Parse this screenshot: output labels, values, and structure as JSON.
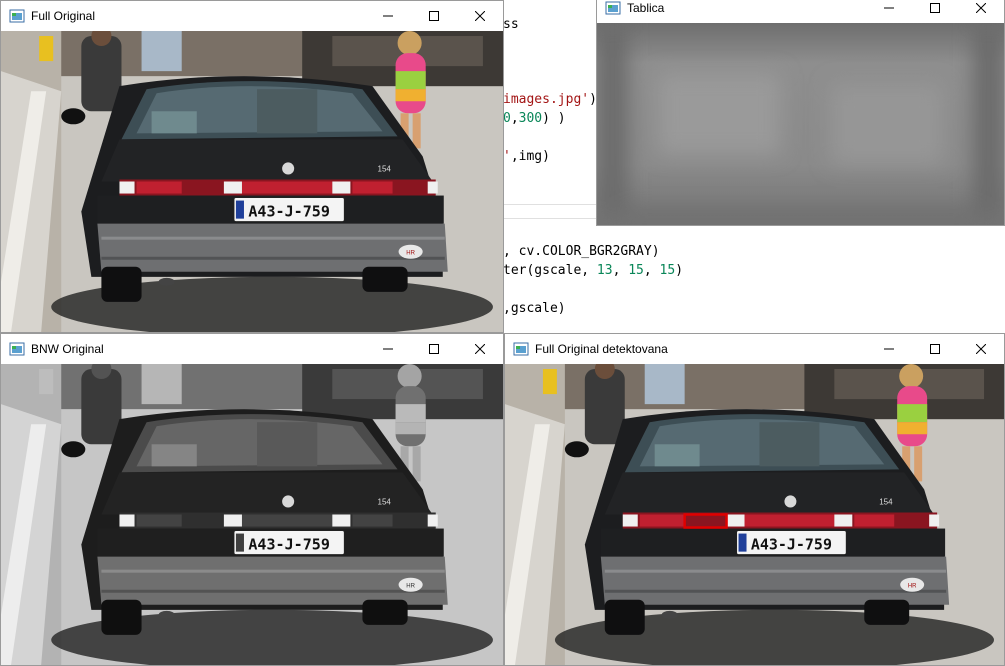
{
  "editor": {
    "lines": [
      {
        "id": "l1",
        "parts": [
          {
            "t": "ss",
            "c": ""
          }
        ]
      },
      {
        "id": "l2",
        "parts": [
          {
            "t": "images.jpg'",
            "c": "str"
          },
          {
            "t": ")",
            "c": ""
          }
        ]
      },
      {
        "id": "l3",
        "parts": [
          {
            "t": "0",
            "c": "num"
          },
          {
            "t": ",",
            "c": ""
          },
          {
            "t": "300",
            "c": "num"
          },
          {
            "t": ") )",
            "c": ""
          }
        ]
      },
      {
        "id": "l4",
        "parts": [
          {
            "t": "'",
            "c": "str"
          },
          {
            "t": ",img)",
            "c": ""
          }
        ]
      },
      {
        "id": "l5",
        "parts": [
          {
            "t": ", cv.COLOR_BGR2GRAY)",
            "c": ""
          }
        ]
      },
      {
        "id": "l6",
        "parts": [
          {
            "t": "ter(gscale, ",
            "c": ""
          },
          {
            "t": "13",
            "c": "num"
          },
          {
            "t": ", ",
            "c": ""
          },
          {
            "t": "15",
            "c": "num"
          },
          {
            "t": ", ",
            "c": ""
          },
          {
            "t": "15",
            "c": "num"
          },
          {
            "t": ")",
            "c": ""
          }
        ]
      },
      {
        "id": "l7",
        "parts": [
          {
            "t": ",gscale)",
            "c": ""
          }
        ]
      }
    ]
  },
  "windows": {
    "full_original": {
      "title": "Full Original"
    },
    "tablica": {
      "title": "Tablica"
    },
    "bnw_original": {
      "title": "BNW Original"
    },
    "detected": {
      "title": "Full Original detektovana"
    }
  },
  "car": {
    "plate_text": "A43-J-759",
    "badge_model": "154",
    "badge_brand": "HR"
  },
  "colors": {
    "detection_box": "#e00000",
    "tablica_blur": "#8a8a8a"
  },
  "icons": {
    "app": "opencv-window-icon",
    "minimize": "minimize-icon",
    "maximize": "maximize-icon",
    "close": "close-icon"
  }
}
